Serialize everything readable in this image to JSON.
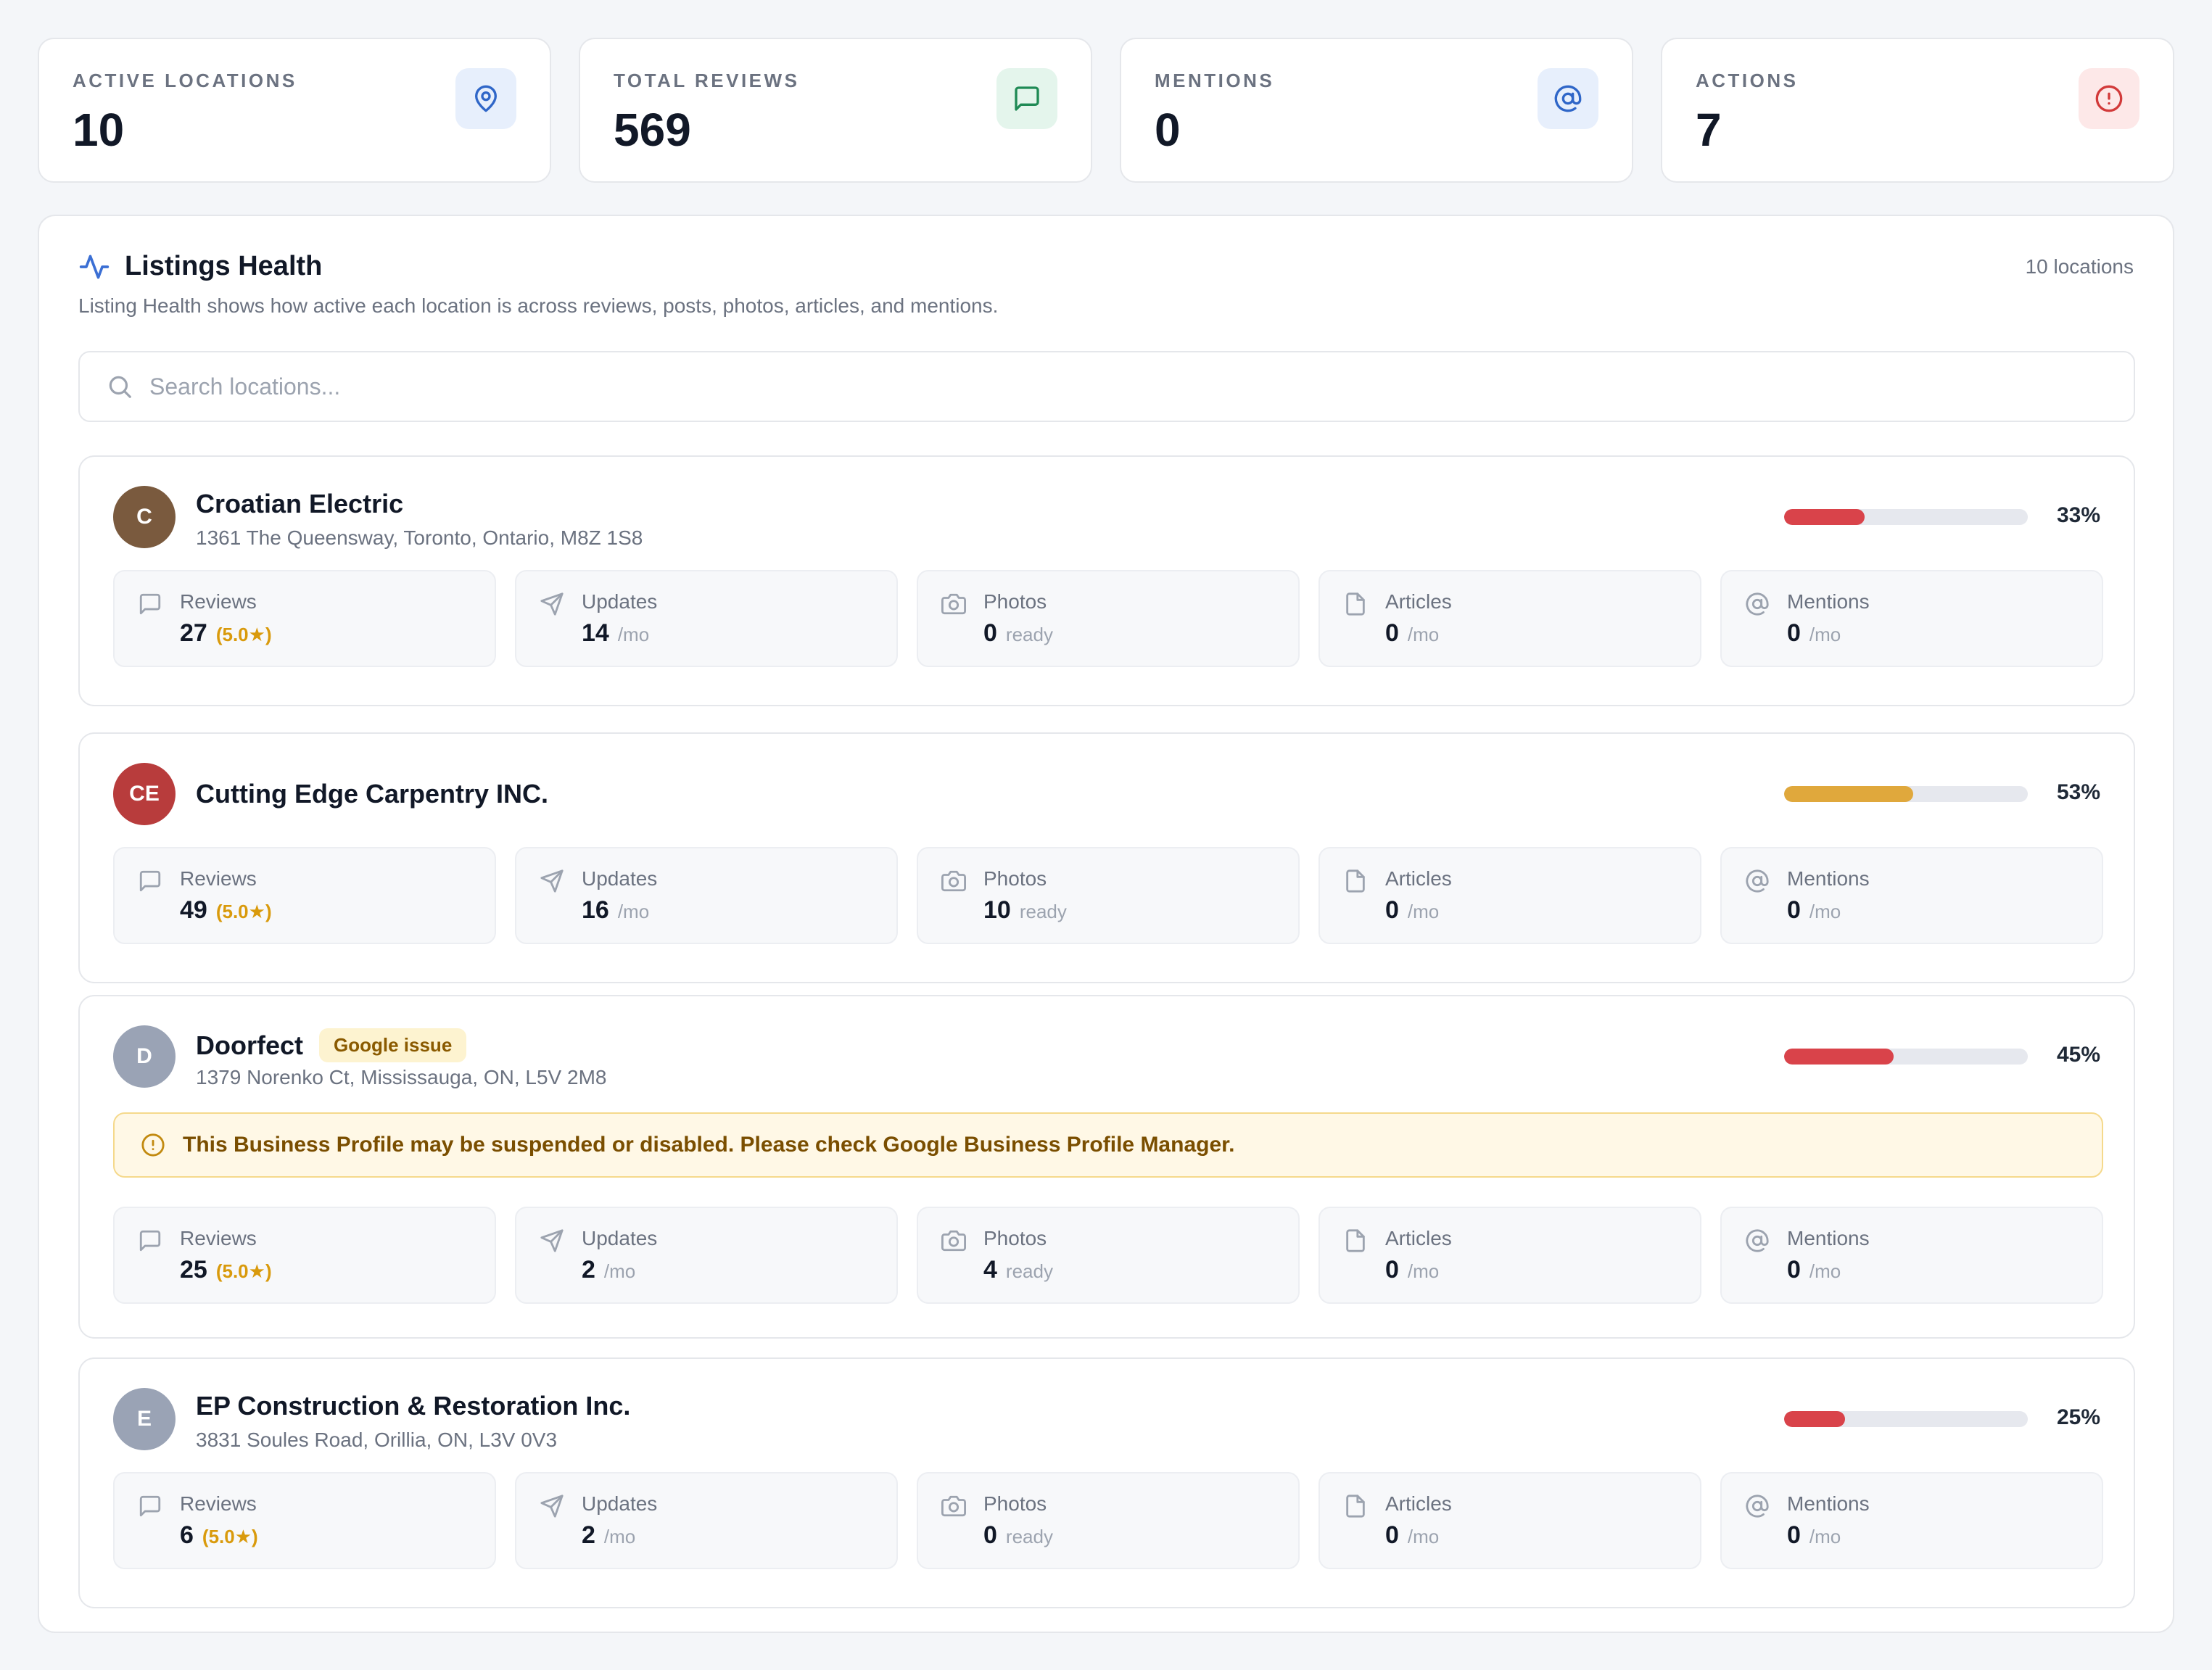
{
  "stats": [
    {
      "label": "ACTIVE LOCATIONS",
      "value": "10",
      "icon": "map-pin-icon",
      "icon_color": "#2f66c8",
      "icon_bg": "#e7effc"
    },
    {
      "label": "TOTAL REVIEWS",
      "value": "569",
      "icon": "message-square-icon",
      "icon_color": "#1f8a55",
      "icon_bg": "#e4f5ec"
    },
    {
      "label": "MENTIONS",
      "value": "0",
      "icon": "at-sign-icon",
      "icon_color": "#2f66c8",
      "icon_bg": "#e7effc"
    },
    {
      "label": "ACTIONS",
      "value": "7",
      "icon": "alert-circle-icon",
      "icon_color": "#d23a3a",
      "icon_bg": "#fde8e8"
    }
  ],
  "panel": {
    "title": "Listings Health",
    "count": "10 locations",
    "description": "Listing Health shows how active each location is across reviews, posts, photos, articles, and mentions.",
    "search_placeholder": "Search locations..."
  },
  "metric_labels": {
    "reviews": "Reviews",
    "updates": "Updates",
    "photos": "Photos",
    "articles": "Articles",
    "mentions": "Mentions",
    "per_month": "/mo",
    "ready": "ready"
  },
  "locations": [
    {
      "initials": "C",
      "avatar_color": "#7a5a3e",
      "name": "Croatian Electric",
      "address": "1361 The Queensway, Toronto, Ontario, M8Z 1S8",
      "badge": "",
      "health": 33,
      "health_label": "33%",
      "bar_color": "#d9434a",
      "warning": "",
      "reviews": "27",
      "rating": "(5.0★)",
      "updates": "14",
      "photos": "0",
      "articles": "0",
      "mentions": "0"
    },
    {
      "initials": "CE",
      "avatar_color": "#b83c3c",
      "name": "Cutting Edge Carpentry INC.",
      "address": "",
      "badge": "",
      "health": 53,
      "health_label": "53%",
      "bar_color": "#e0a83c",
      "warning": "",
      "reviews": "49",
      "rating": "(5.0★)",
      "updates": "16",
      "photos": "10",
      "articles": "0",
      "mentions": "0"
    },
    {
      "initials": "D",
      "avatar_color": "#9aa3b5",
      "name": "Doorfect",
      "address": "1379 Norenko Ct, Mississauga, ON, L5V 2M8",
      "badge": "Google issue",
      "health": 45,
      "health_label": "45%",
      "bar_color": "#d9434a",
      "warning": "This Business Profile may be suspended or disabled. Please check Google Business Profile Manager.",
      "reviews": "25",
      "rating": "(5.0★)",
      "updates": "2",
      "photos": "4",
      "articles": "0",
      "mentions": "0"
    },
    {
      "initials": "E",
      "avatar_color": "#9aa3b5",
      "name": "EP Construction & Restoration Inc.",
      "address": "3831 Soules Road, Orillia, ON, L3V 0V3",
      "badge": "",
      "health": 25,
      "health_label": "25%",
      "bar_color": "#d9434a",
      "warning": "",
      "reviews": "6",
      "rating": "(5.0★)",
      "updates": "2",
      "photos": "0",
      "articles": "0",
      "mentions": "0"
    }
  ]
}
